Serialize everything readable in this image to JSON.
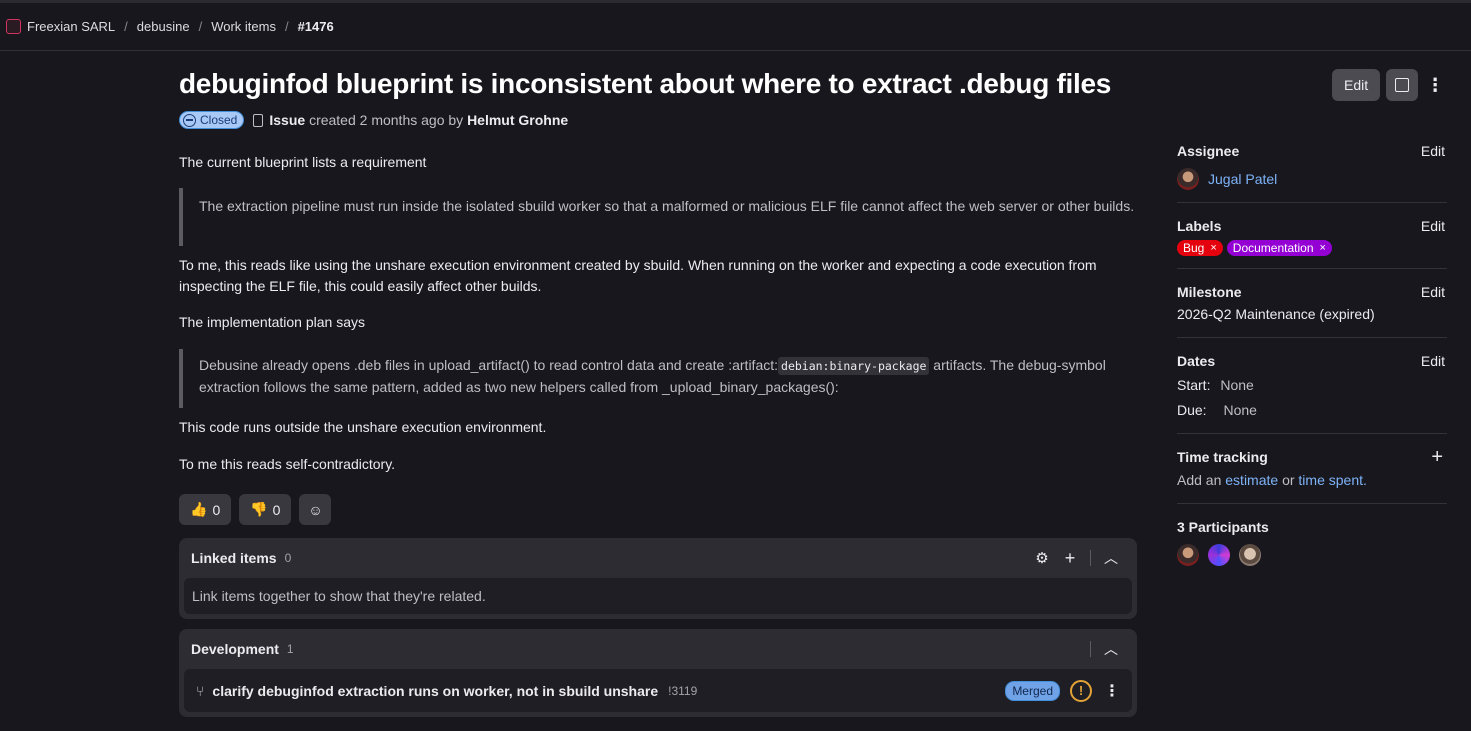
{
  "breadcrumb": {
    "items": [
      "Freexian SARL",
      "debusine",
      "Work items"
    ],
    "current": "#1476",
    "separator": "/"
  },
  "issue": {
    "title": "debuginfod blueprint is inconsistent about where to extract .debug files",
    "status": "Closed",
    "type": "Issue",
    "created_text": "created 2 months ago by",
    "author": "Helmut Grohne"
  },
  "header_actions": {
    "edit_label": "Edit"
  },
  "body": {
    "p1": "The current blueprint lists a requirement",
    "quote1": "The extraction pipeline must run inside the isolated sbuild worker so that a malformed or malicious ELF file cannot affect the web server or other builds.",
    "p2": "To me, this reads like using the unshare execution environment created by sbuild. When running on the worker and expecting a code execution from inspecting the ELF file, this could easily affect other builds.",
    "p3": "The implementation plan says",
    "quote2_before": "Debusine already opens .deb files in upload_artifact() to read control data and create :artifact:",
    "quote2_code": "debian:binary-package",
    "quote2_after": " artifacts. The debug-symbol extraction follows the same pattern, added as two new helpers called from _upload_binary_packages():",
    "p4": "This code runs outside the unshare execution environment.",
    "p5": "To me this reads self-contradictory."
  },
  "reactions": {
    "thumbs_up": "0",
    "thumbs_down": "0"
  },
  "linked_items": {
    "title": "Linked items",
    "count": "0",
    "empty_text": "Link items together to show that they're related."
  },
  "development": {
    "title": "Development",
    "count": "1",
    "mr_title": "clarify debuginfod extraction runs on worker, not in sbuild unshare",
    "mr_id": "!3119",
    "mr_status": "Merged"
  },
  "sidebar": {
    "assignee": {
      "title": "Assignee",
      "edit": "Edit",
      "name": "Jugal Patel"
    },
    "labels": {
      "title": "Labels",
      "edit": "Edit",
      "items": [
        "Bug",
        "Documentation"
      ]
    },
    "milestone": {
      "title": "Milestone",
      "edit": "Edit",
      "value": "2026-Q2 Maintenance (expired)"
    },
    "dates": {
      "title": "Dates",
      "edit": "Edit",
      "start_label": "Start:",
      "start": "None",
      "due_label": "Due:",
      "due": "None"
    },
    "time_tracking": {
      "title": "Time tracking",
      "add_an": "Add an",
      "estimate": "estimate",
      "or": "or",
      "time_spent": "time spent."
    },
    "participants": {
      "title": "3 Participants"
    }
  },
  "colors": {
    "background": "#18171d",
    "closed_badge": "#a8c8f5",
    "bug_label": "#e5000d",
    "doc_label": "#9400d3",
    "link": "#7eb3f7",
    "merged_badge": "#6fa2e6"
  }
}
